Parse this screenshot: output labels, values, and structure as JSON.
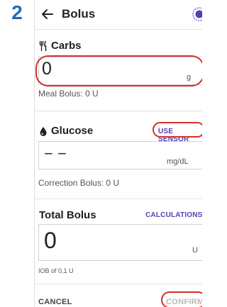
{
  "step_number": "2",
  "header": {
    "title": "Bolus"
  },
  "carbs": {
    "title": "Carbs",
    "value": "0",
    "unit": "g",
    "helper": "Meal Bolus: 0 U"
  },
  "glucose": {
    "title": "Glucose",
    "use_sensor_label": "USE SENSOR",
    "value": "− −",
    "unit": "mg/dL",
    "helper": "Correction Bolus: 0 U"
  },
  "total": {
    "title": "Total Bolus",
    "calculations_label": "CALCULATIONS",
    "value": "0",
    "unit": "U",
    "helper": "IOB of 0,1 U"
  },
  "footer": {
    "cancel_label": "CANCEL",
    "confirm_label": "CONFIRM"
  },
  "colors": {
    "step_number": "#1d6fb8",
    "accent": "#5a3db0",
    "highlight": "#d32f2f"
  }
}
